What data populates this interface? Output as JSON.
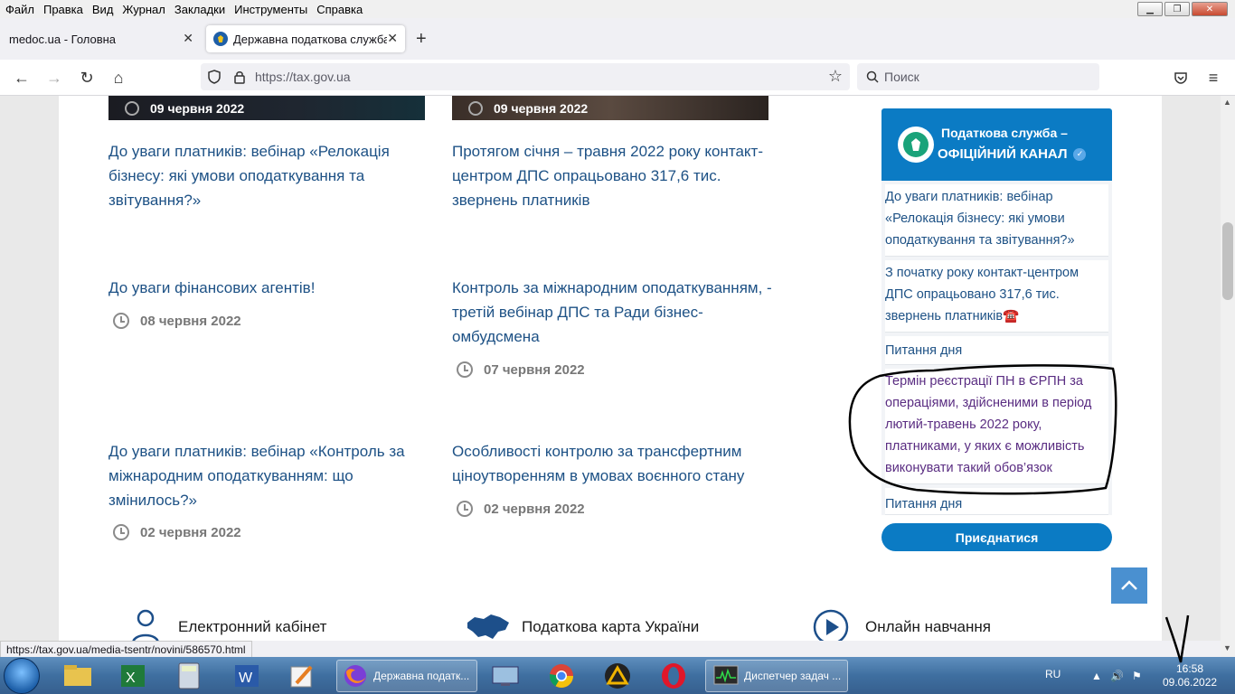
{
  "menu": [
    "Файл",
    "Правка",
    "Вид",
    "Журнал",
    "Закладки",
    "Инструменты",
    "Справка"
  ],
  "tabs": [
    {
      "label": "medoc.ua - Головна"
    },
    {
      "label": "Державна податкова служба У"
    }
  ],
  "address": {
    "url": "https://tax.gov.ua"
  },
  "search": {
    "placeholder": "Поиск"
  },
  "news": [
    {
      "title_lines": [
        "До уваги платників: вебінар «Релокація",
        "бізнесу: які умови оподаткування та",
        "звітування?»"
      ],
      "date": "09 червня 2022"
    },
    {
      "title_lines": [
        "Протягом січня – травня 2022 року контакт-",
        "центром ДПС опрацьовано 317,6 тис.",
        "звернень платників"
      ],
      "date": "09 червня 2022"
    },
    {
      "title_lines": [
        "До уваги фінансових агентів!"
      ],
      "date": "08 червня 2022"
    },
    {
      "title_lines": [
        "Контроль за міжнародним оподаткуванням, -",
        "третій вебінар ДПС та Ради бізнес-",
        "омбудсмена"
      ],
      "date": "07 червня 2022"
    },
    {
      "title_lines": [
        "До уваги платників: вебінар «Контроль за",
        "міжнародним оподаткуванням: що",
        "змінилось?»"
      ],
      "date": "02 червня 2022"
    },
    {
      "title_lines": [
        "Особливості контролю за трансфертним",
        "ціноутворенням в умовах воєнного стану"
      ],
      "date": "02 червня 2022"
    }
  ],
  "telegram": {
    "title_line1": "Податкова служба –",
    "title_line2": "ОФІЦІЙНИЙ КАНАЛ",
    "posts": [
      {
        "lines": [
          "До уваги платників: вебінар",
          "«Релокація бізнесу: які умови",
          "оподаткування та звітування?»"
        ]
      },
      {
        "lines": [
          "З початку року контакт-центром",
          "ДПС опрацьовано 317,6 тис.",
          "звернень платників☎️"
        ]
      },
      {
        "lines": [
          "Питання дня"
        ]
      },
      {
        "lines": [
          "Термін реєстрації ПН в ЄРПН за",
          "операціями, здійсненими в період",
          "лютий-травень 2022 року,",
          "платниками, у яких є можливість",
          "виконувати такий обов’язок"
        ]
      },
      {
        "lines": [
          "Питання дня"
        ]
      }
    ],
    "join_label": "Приєднатися"
  },
  "bottom_links": [
    "Електронний кабінет",
    "Податкова карта України",
    "Онлайн навчання"
  ],
  "status_url": "https://tax.gov.ua/media-tsentr/novini/586570.html",
  "taskbar": {
    "firefox_label": "Державна податк...",
    "taskmgr_label": "Диспетчер задач ...",
    "lang": "RU",
    "time": "16:58",
    "date": "09.06.2022"
  }
}
